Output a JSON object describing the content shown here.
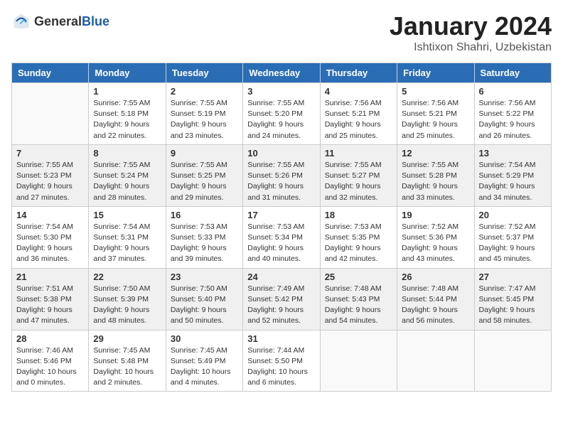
{
  "header": {
    "logo_general": "General",
    "logo_blue": "Blue",
    "month_year": "January 2024",
    "location": "Ishtixon Shahri, Uzbekistan"
  },
  "weekdays": [
    "Sunday",
    "Monday",
    "Tuesday",
    "Wednesday",
    "Thursday",
    "Friday",
    "Saturday"
  ],
  "weeks": [
    [
      {
        "day": "",
        "sunrise": "",
        "sunset": "",
        "daylight": ""
      },
      {
        "day": "1",
        "sunrise": "Sunrise: 7:55 AM",
        "sunset": "Sunset: 5:18 PM",
        "daylight": "Daylight: 9 hours and 22 minutes."
      },
      {
        "day": "2",
        "sunrise": "Sunrise: 7:55 AM",
        "sunset": "Sunset: 5:19 PM",
        "daylight": "Daylight: 9 hours and 23 minutes."
      },
      {
        "day": "3",
        "sunrise": "Sunrise: 7:55 AM",
        "sunset": "Sunset: 5:20 PM",
        "daylight": "Daylight: 9 hours and 24 minutes."
      },
      {
        "day": "4",
        "sunrise": "Sunrise: 7:56 AM",
        "sunset": "Sunset: 5:21 PM",
        "daylight": "Daylight: 9 hours and 25 minutes."
      },
      {
        "day": "5",
        "sunrise": "Sunrise: 7:56 AM",
        "sunset": "Sunset: 5:21 PM",
        "daylight": "Daylight: 9 hours and 25 minutes."
      },
      {
        "day": "6",
        "sunrise": "Sunrise: 7:56 AM",
        "sunset": "Sunset: 5:22 PM",
        "daylight": "Daylight: 9 hours and 26 minutes."
      }
    ],
    [
      {
        "day": "7",
        "sunrise": "Sunrise: 7:55 AM",
        "sunset": "Sunset: 5:23 PM",
        "daylight": "Daylight: 9 hours and 27 minutes."
      },
      {
        "day": "8",
        "sunrise": "Sunrise: 7:55 AM",
        "sunset": "Sunset: 5:24 PM",
        "daylight": "Daylight: 9 hours and 28 minutes."
      },
      {
        "day": "9",
        "sunrise": "Sunrise: 7:55 AM",
        "sunset": "Sunset: 5:25 PM",
        "daylight": "Daylight: 9 hours and 29 minutes."
      },
      {
        "day": "10",
        "sunrise": "Sunrise: 7:55 AM",
        "sunset": "Sunset: 5:26 PM",
        "daylight": "Daylight: 9 hours and 31 minutes."
      },
      {
        "day": "11",
        "sunrise": "Sunrise: 7:55 AM",
        "sunset": "Sunset: 5:27 PM",
        "daylight": "Daylight: 9 hours and 32 minutes."
      },
      {
        "day": "12",
        "sunrise": "Sunrise: 7:55 AM",
        "sunset": "Sunset: 5:28 PM",
        "daylight": "Daylight: 9 hours and 33 minutes."
      },
      {
        "day": "13",
        "sunrise": "Sunrise: 7:54 AM",
        "sunset": "Sunset: 5:29 PM",
        "daylight": "Daylight: 9 hours and 34 minutes."
      }
    ],
    [
      {
        "day": "14",
        "sunrise": "Sunrise: 7:54 AM",
        "sunset": "Sunset: 5:30 PM",
        "daylight": "Daylight: 9 hours and 36 minutes."
      },
      {
        "day": "15",
        "sunrise": "Sunrise: 7:54 AM",
        "sunset": "Sunset: 5:31 PM",
        "daylight": "Daylight: 9 hours and 37 minutes."
      },
      {
        "day": "16",
        "sunrise": "Sunrise: 7:53 AM",
        "sunset": "Sunset: 5:33 PM",
        "daylight": "Daylight: 9 hours and 39 minutes."
      },
      {
        "day": "17",
        "sunrise": "Sunrise: 7:53 AM",
        "sunset": "Sunset: 5:34 PM",
        "daylight": "Daylight: 9 hours and 40 minutes."
      },
      {
        "day": "18",
        "sunrise": "Sunrise: 7:53 AM",
        "sunset": "Sunset: 5:35 PM",
        "daylight": "Daylight: 9 hours and 42 minutes."
      },
      {
        "day": "19",
        "sunrise": "Sunrise: 7:52 AM",
        "sunset": "Sunset: 5:36 PM",
        "daylight": "Daylight: 9 hours and 43 minutes."
      },
      {
        "day": "20",
        "sunrise": "Sunrise: 7:52 AM",
        "sunset": "Sunset: 5:37 PM",
        "daylight": "Daylight: 9 hours and 45 minutes."
      }
    ],
    [
      {
        "day": "21",
        "sunrise": "Sunrise: 7:51 AM",
        "sunset": "Sunset: 5:38 PM",
        "daylight": "Daylight: 9 hours and 47 minutes."
      },
      {
        "day": "22",
        "sunrise": "Sunrise: 7:50 AM",
        "sunset": "Sunset: 5:39 PM",
        "daylight": "Daylight: 9 hours and 48 minutes."
      },
      {
        "day": "23",
        "sunrise": "Sunrise: 7:50 AM",
        "sunset": "Sunset: 5:40 PM",
        "daylight": "Daylight: 9 hours and 50 minutes."
      },
      {
        "day": "24",
        "sunrise": "Sunrise: 7:49 AM",
        "sunset": "Sunset: 5:42 PM",
        "daylight": "Daylight: 9 hours and 52 minutes."
      },
      {
        "day": "25",
        "sunrise": "Sunrise: 7:48 AM",
        "sunset": "Sunset: 5:43 PM",
        "daylight": "Daylight: 9 hours and 54 minutes."
      },
      {
        "day": "26",
        "sunrise": "Sunrise: 7:48 AM",
        "sunset": "Sunset: 5:44 PM",
        "daylight": "Daylight: 9 hours and 56 minutes."
      },
      {
        "day": "27",
        "sunrise": "Sunrise: 7:47 AM",
        "sunset": "Sunset: 5:45 PM",
        "daylight": "Daylight: 9 hours and 58 minutes."
      }
    ],
    [
      {
        "day": "28",
        "sunrise": "Sunrise: 7:46 AM",
        "sunset": "Sunset: 5:46 PM",
        "daylight": "Daylight: 10 hours and 0 minutes."
      },
      {
        "day": "29",
        "sunrise": "Sunrise: 7:45 AM",
        "sunset": "Sunset: 5:48 PM",
        "daylight": "Daylight: 10 hours and 2 minutes."
      },
      {
        "day": "30",
        "sunrise": "Sunrise: 7:45 AM",
        "sunset": "Sunset: 5:49 PM",
        "daylight": "Daylight: 10 hours and 4 minutes."
      },
      {
        "day": "31",
        "sunrise": "Sunrise: 7:44 AM",
        "sunset": "Sunset: 5:50 PM",
        "daylight": "Daylight: 10 hours and 6 minutes."
      },
      {
        "day": "",
        "sunrise": "",
        "sunset": "",
        "daylight": ""
      },
      {
        "day": "",
        "sunrise": "",
        "sunset": "",
        "daylight": ""
      },
      {
        "day": "",
        "sunrise": "",
        "sunset": "",
        "daylight": ""
      }
    ]
  ]
}
